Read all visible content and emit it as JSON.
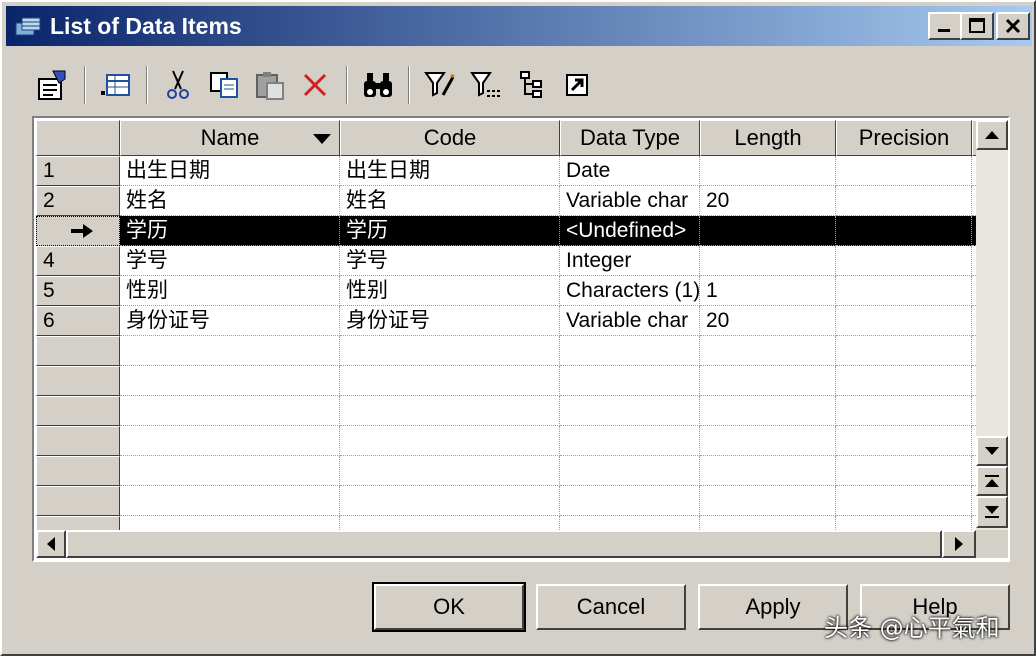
{
  "window": {
    "title": "List of Data Items"
  },
  "toolbar": {
    "items": [
      "properties-icon",
      "add-columns-icon",
      "cut-icon",
      "copy-icon",
      "paste-icon",
      "delete-icon",
      "find-icon",
      "filter-icon",
      "filter-options-icon",
      "hierarchy-icon",
      "open-icon"
    ]
  },
  "grid": {
    "columns": [
      "Name",
      "Code",
      "Data Type",
      "Length",
      "Precision"
    ],
    "rows": [
      {
        "num": "1",
        "name": "出生日期",
        "code": "出生日期",
        "data_type": "Date",
        "length": "",
        "precision": ""
      },
      {
        "num": "2",
        "name": "姓名",
        "code": "姓名",
        "data_type": "Variable char",
        "length": "20",
        "precision": ""
      },
      {
        "num": "",
        "name": "学历",
        "code": "学历",
        "data_type": "<Undefined>",
        "length": "",
        "precision": ""
      },
      {
        "num": "4",
        "name": "学号",
        "code": "学号",
        "data_type": "Integer",
        "length": "",
        "precision": ""
      },
      {
        "num": "5",
        "name": "性别",
        "code": "性别",
        "data_type": "Characters (1)",
        "length": "1",
        "precision": ""
      },
      {
        "num": "6",
        "name": "身份证号",
        "code": "身份证号",
        "data_type": "Variable char",
        "length": "20",
        "precision": ""
      }
    ],
    "selected_row": 2
  },
  "buttons": {
    "ok": "OK",
    "cancel": "Cancel",
    "apply": "Apply",
    "help": "Help"
  },
  "watermark": "头条 @心平氣和"
}
